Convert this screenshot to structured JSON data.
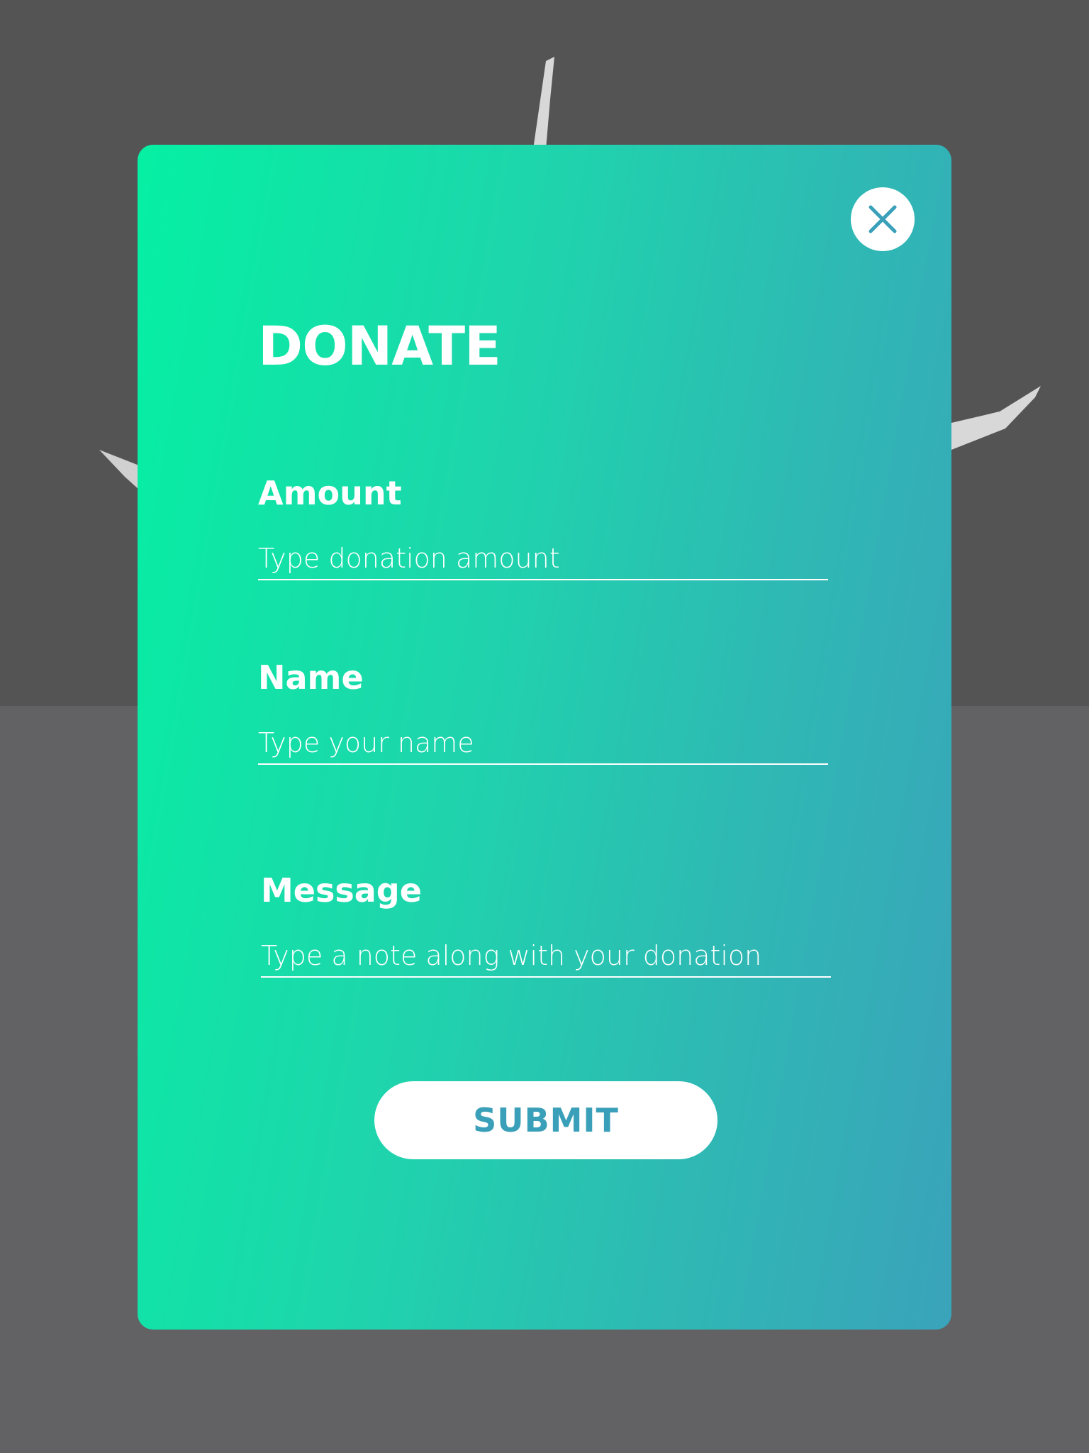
{
  "modal": {
    "title": "DONATE",
    "close_icon": "close-icon",
    "submit_label": "SUBMIT"
  },
  "form": {
    "amount": {
      "label": "Amount",
      "placeholder": "Type donation amount",
      "value": ""
    },
    "name": {
      "label": "Name",
      "placeholder": "Type your name",
      "value": ""
    },
    "message": {
      "label": "Message",
      "placeholder": "Type a note along with your donation",
      "value": ""
    }
  },
  "colors": {
    "gradient_start": "#05f0a3",
    "gradient_end": "#3aa3ba",
    "accent": "#3a9fb8",
    "backdrop_top": "#545454",
    "backdrop_bottom": "#626264"
  }
}
